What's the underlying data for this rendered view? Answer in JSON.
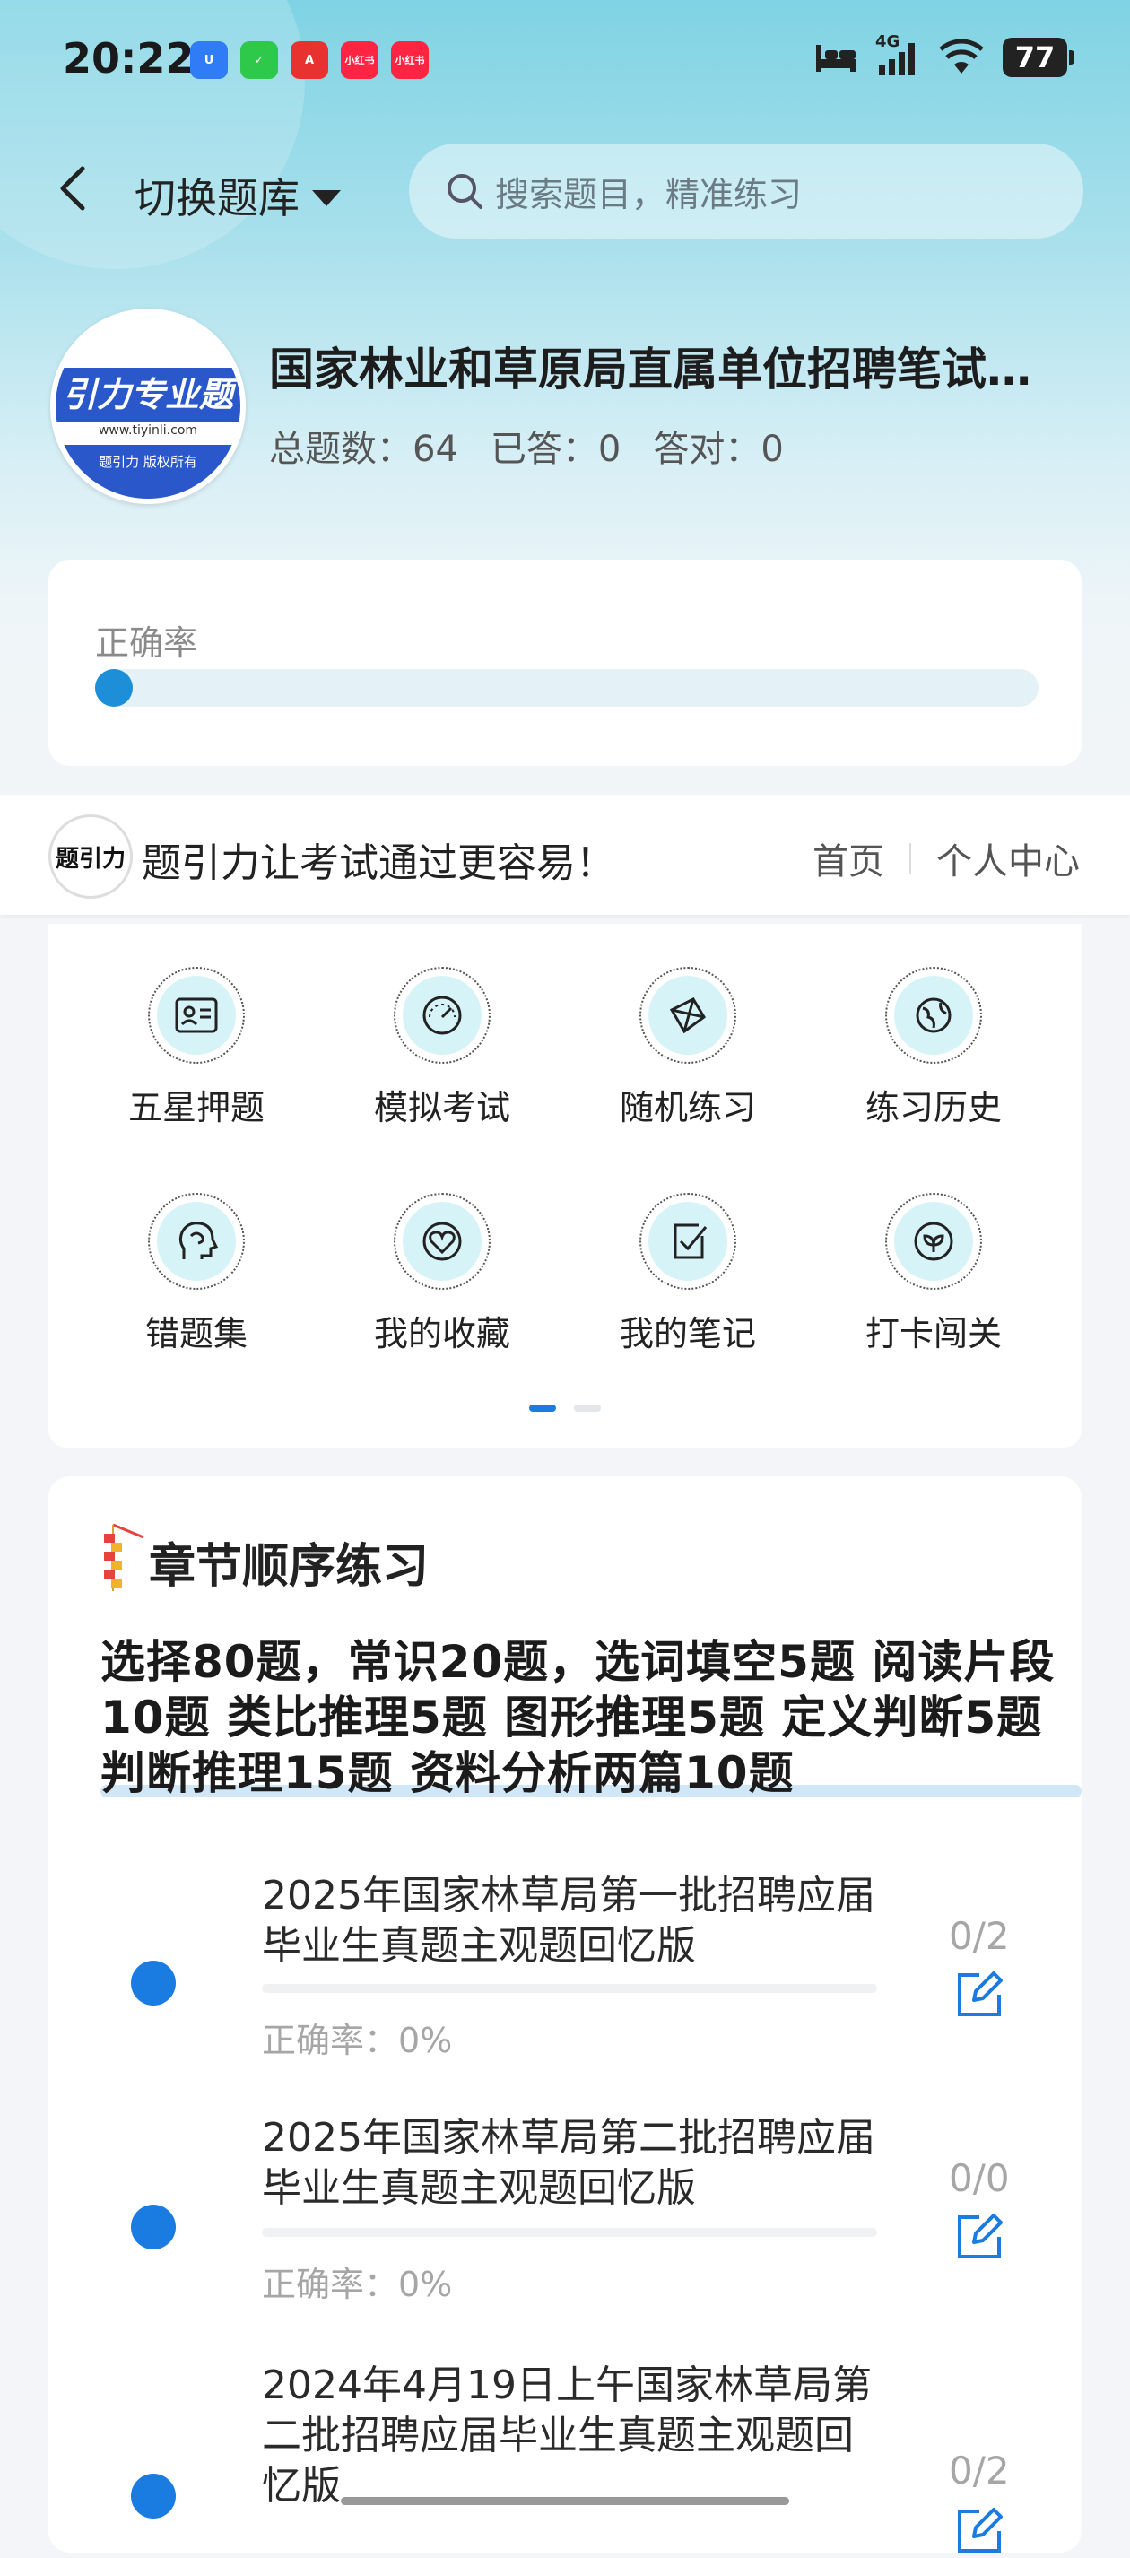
{
  "status_bar": {
    "time": "20:22",
    "apps": [
      {
        "icon": "shield-app-icon",
        "color": "#2f7cf6",
        "label": "U"
      },
      {
        "icon": "wechat-icon",
        "color": "#2ec84b",
        "label": "✓"
      },
      {
        "icon": "a-app-icon",
        "color": "#e8322f",
        "label": "A"
      },
      {
        "icon": "xiaohongshu-icon",
        "color": "#ff2442",
        "label": "小红书"
      },
      {
        "icon": "xiaohongshu-icon",
        "color": "#ff2442",
        "label": "小红书"
      }
    ],
    "network": "4G",
    "battery": "77"
  },
  "header": {
    "switch_label": "切换题库",
    "search_placeholder": "搜索题目，精准练习"
  },
  "bank": {
    "logo_text": "引力专业题",
    "logo_url": "www.tiyinli.com",
    "logo_footer": "题引力 版权所有",
    "title": "国家林业和草原局直属单位招聘笔试…",
    "stats": [
      "总题数：64",
      "已答：0",
      "答对：0"
    ]
  },
  "accuracy": {
    "label": "正确率",
    "value": 0
  },
  "banner": {
    "logo_text": "题引力",
    "slogan": "题引力让考试通过更容易！",
    "home": "首页",
    "profile": "个人中心"
  },
  "grid": {
    "items": [
      {
        "label": "五星押题",
        "icon": "id-card-icon"
      },
      {
        "label": "模拟考试",
        "icon": "gauge-icon"
      },
      {
        "label": "随机练习",
        "icon": "network-icon"
      },
      {
        "label": "练习历史",
        "icon": "globe-icon"
      },
      {
        "label": "错题集",
        "icon": "brain-head-icon"
      },
      {
        "label": "我的收藏",
        "icon": "heart-icon"
      },
      {
        "label": "我的笔记",
        "icon": "checked-note-icon"
      },
      {
        "label": "打卡闯关",
        "icon": "leaf-badge-icon"
      }
    ],
    "page_index": 0,
    "page_count": 2
  },
  "chapters": {
    "title": "章节顺序练习",
    "description": "选择80题，常识20题，选词填空5题 阅读片段10题 类比推理5题 图形推理5题 定义判断5题 判断推理15题 资料分析两篇10题",
    "items": [
      {
        "name": "2025年国家林草局第一批招聘应届毕业生真题主观题回忆版",
        "accuracy": "正确率：0%",
        "count": "0/2"
      },
      {
        "name": "2025年国家林草局第二批招聘应届毕业生真题主观题回忆版",
        "accuracy": "正确率：0%",
        "count": "0/0"
      },
      {
        "name": "2024年4月19日上午国家林草局第二批招聘应届毕业生真题主观题回忆版",
        "accuracy": "",
        "count": "0/2"
      }
    ]
  }
}
